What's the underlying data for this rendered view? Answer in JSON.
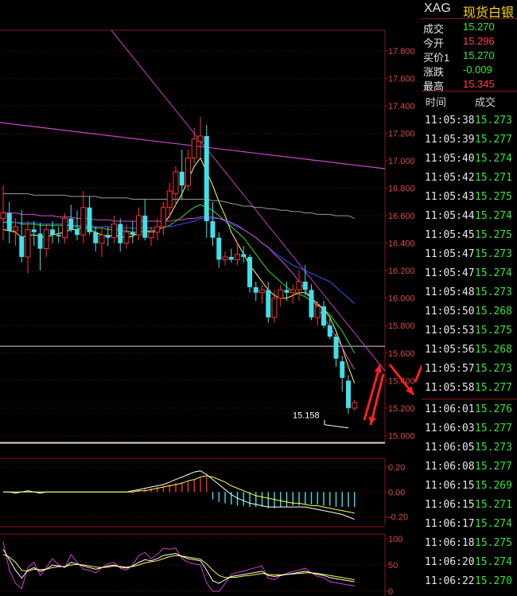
{
  "chart_data": [
    {
      "type": "candlestick",
      "ylim": [
        14.95,
        17.95
      ],
      "yticks": [
        "17.800",
        "17.600",
        "17.400",
        "17.200",
        "17.000",
        "16.800",
        "16.600",
        "16.400",
        "16.200",
        "16.000",
        "15.800",
        "15.600",
        "15.400",
        "15.200",
        "15.000"
      ],
      "candles": [
        [
          16.58,
          16.82,
          16.42,
          16.62
        ],
        [
          16.62,
          16.7,
          16.4,
          16.49
        ],
        [
          16.49,
          16.58,
          16.38,
          16.52
        ],
        [
          16.45,
          16.64,
          16.26,
          16.3
        ],
        [
          16.3,
          16.56,
          16.18,
          16.5
        ],
        [
          16.5,
          16.56,
          16.38,
          16.48
        ],
        [
          16.47,
          16.55,
          16.2,
          16.36
        ],
        [
          16.36,
          16.54,
          16.3,
          16.5
        ],
        [
          16.5,
          16.56,
          16.4,
          16.46
        ],
        [
          16.46,
          16.52,
          16.4,
          16.45
        ],
        [
          16.44,
          16.62,
          16.4,
          16.58
        ],
        [
          16.58,
          16.68,
          16.48,
          16.5
        ],
        [
          16.5,
          16.64,
          16.42,
          16.46
        ],
        [
          16.46,
          16.78,
          16.4,
          16.66
        ],
        [
          16.66,
          16.74,
          16.46,
          16.48
        ],
        [
          16.48,
          16.52,
          16.34,
          16.4
        ],
        [
          16.4,
          16.52,
          16.3,
          16.46
        ],
        [
          16.46,
          16.52,
          16.38,
          16.44
        ],
        [
          16.44,
          16.6,
          16.4,
          16.54
        ],
        [
          16.54,
          16.58,
          16.34,
          16.4
        ],
        [
          16.4,
          16.54,
          16.36,
          16.48
        ],
        [
          16.48,
          16.56,
          16.4,
          16.46
        ],
        [
          16.46,
          16.66,
          16.42,
          16.6
        ],
        [
          16.6,
          16.72,
          16.42,
          16.44
        ],
        [
          16.44,
          16.52,
          16.38,
          16.48
        ],
        [
          16.48,
          16.58,
          16.42,
          16.52
        ],
        [
          16.52,
          16.7,
          16.46,
          16.66
        ],
        [
          16.66,
          16.84,
          16.58,
          16.78
        ],
        [
          16.76,
          16.96,
          16.68,
          16.92
        ],
        [
          16.92,
          17.08,
          16.72,
          16.82
        ],
        [
          16.82,
          17.08,
          16.78,
          17.02
        ],
        [
          17.02,
          17.24,
          16.98,
          17.16
        ],
        [
          17.14,
          17.32,
          17.02,
          17.18
        ],
        [
          17.18,
          17.26,
          16.44,
          16.56
        ],
        [
          16.56,
          16.7,
          16.38,
          16.44
        ],
        [
          16.44,
          16.48,
          16.22,
          16.28
        ],
        [
          16.28,
          16.34,
          16.24,
          16.3
        ],
        [
          16.3,
          16.36,
          16.26,
          16.28
        ],
        [
          16.28,
          16.4,
          16.24,
          16.32
        ],
        [
          16.32,
          16.38,
          16.26,
          16.3
        ],
        [
          16.3,
          16.32,
          16.04,
          16.08
        ],
        [
          16.08,
          16.12,
          15.98,
          16.04
        ],
        [
          16.04,
          16.1,
          15.96,
          16.06
        ],
        [
          16.06,
          16.12,
          15.82,
          15.86
        ],
        [
          15.86,
          16.06,
          15.82,
          16.0
        ],
        [
          16.0,
          16.1,
          15.94,
          16.06
        ],
        [
          16.06,
          16.12,
          15.98,
          16.04
        ],
        [
          16.04,
          16.1,
          15.96,
          16.06
        ],
        [
          16.06,
          16.2,
          15.98,
          16.12
        ],
        [
          16.12,
          16.24,
          16.02,
          16.06
        ],
        [
          16.06,
          16.1,
          15.84,
          15.86
        ],
        [
          15.86,
          15.98,
          15.8,
          15.94
        ],
        [
          15.94,
          15.98,
          15.78,
          15.8
        ],
        [
          15.8,
          15.86,
          15.7,
          15.72
        ],
        [
          15.72,
          15.74,
          15.5,
          15.56
        ],
        [
          15.54,
          15.58,
          15.32,
          15.42
        ],
        [
          15.4,
          15.44,
          15.16,
          15.2
        ],
        [
          15.2,
          15.26,
          15.18,
          15.24
        ]
      ],
      "ma": [
        {
          "color": "#ffff66",
          "values": [
            16.5,
            16.49,
            16.48,
            16.44,
            16.46,
            16.46,
            16.45,
            16.44,
            16.46,
            16.47,
            16.48,
            16.5,
            16.5,
            16.52,
            16.5,
            16.48,
            16.46,
            16.45,
            16.46,
            16.45,
            16.44,
            16.45,
            16.48,
            16.49,
            16.48,
            16.49,
            16.54,
            16.6,
            16.68,
            16.76,
            16.86,
            16.96,
            17.02,
            16.92,
            16.82,
            16.7,
            16.6,
            16.48,
            16.4,
            16.32,
            16.24,
            16.18,
            16.12,
            16.06,
            16.02,
            16.0,
            16.0,
            16.02,
            16.04,
            16.04,
            16.0,
            15.96,
            15.92,
            15.86,
            15.76,
            15.64,
            15.5,
            15.38
          ]
        },
        {
          "color": "#33dd33",
          "values": [
            16.55,
            16.55,
            16.55,
            16.54,
            16.54,
            16.54,
            16.53,
            16.53,
            16.53,
            16.53,
            16.53,
            16.53,
            16.52,
            16.52,
            16.52,
            16.51,
            16.51,
            16.5,
            16.5,
            16.49,
            16.49,
            16.48,
            16.48,
            16.49,
            16.49,
            16.5,
            16.51,
            16.53,
            16.56,
            16.59,
            16.63,
            16.66,
            16.68,
            16.66,
            16.64,
            16.6,
            16.56,
            16.52,
            16.48,
            16.44,
            16.38,
            16.32,
            16.26,
            16.2,
            16.16,
            16.12,
            16.08,
            16.05,
            16.03,
            16.01,
            15.98,
            15.95,
            15.92,
            15.88,
            15.82,
            15.76,
            15.68,
            15.6
          ]
        },
        {
          "color": "#3355ff",
          "values": [
            16.56,
            16.56,
            16.55,
            16.55,
            16.55,
            16.55,
            16.54,
            16.54,
            16.54,
            16.54,
            16.54,
            16.53,
            16.53,
            16.53,
            16.53,
            16.52,
            16.52,
            16.52,
            16.51,
            16.51,
            16.51,
            16.51,
            16.51,
            16.51,
            16.51,
            16.51,
            16.52,
            16.52,
            16.53,
            16.54,
            16.55,
            16.56,
            16.58,
            16.58,
            16.58,
            16.58,
            16.56,
            16.54,
            16.52,
            16.5,
            16.47,
            16.44,
            16.4,
            16.37,
            16.33,
            16.3,
            16.27,
            16.24,
            16.22,
            16.2,
            16.18,
            16.16,
            16.14,
            16.12,
            16.08,
            16.04,
            16.0,
            15.96
          ]
        },
        {
          "color": "#d050d0",
          "values": [
            16.62,
            16.62,
            16.62,
            16.61,
            16.61,
            16.61,
            16.6,
            16.6,
            16.6,
            16.59,
            16.59,
            16.59,
            16.58,
            16.58,
            16.58,
            16.57,
            16.57,
            16.57,
            16.56,
            16.56,
            16.56,
            16.56,
            16.56,
            16.56,
            16.56,
            16.56,
            16.56,
            16.56,
            16.57,
            16.57,
            16.58,
            16.58,
            16.59,
            16.59,
            16.59,
            16.58,
            16.57,
            16.55,
            16.53,
            16.5,
            16.47,
            16.44,
            16.4,
            16.37,
            16.32,
            16.28,
            16.23,
            16.18,
            16.12,
            16.06,
            16.0,
            15.93,
            15.86,
            15.79,
            15.72,
            15.64,
            15.56,
            15.48
          ]
        },
        {
          "color": "#9a9a9a",
          "values": [
            16.76,
            16.76,
            16.76,
            16.76,
            16.76,
            16.75,
            16.75,
            16.75,
            16.75,
            16.75,
            16.75,
            16.74,
            16.74,
            16.74,
            16.74,
            16.74,
            16.73,
            16.73,
            16.73,
            16.73,
            16.73,
            16.72,
            16.72,
            16.72,
            16.72,
            16.72,
            16.72,
            16.72,
            16.72,
            16.72,
            16.72,
            16.72,
            16.72,
            16.72,
            16.71,
            16.71,
            16.7,
            16.69,
            16.68,
            16.67,
            16.67,
            16.66,
            16.66,
            16.65,
            16.65,
            16.64,
            16.64,
            16.63,
            16.63,
            16.62,
            16.62,
            16.61,
            16.61,
            16.61,
            16.6,
            16.6,
            16.6,
            16.58
          ]
        }
      ],
      "hlines": [
        "15.65",
        "14.95"
      ],
      "annotation": {
        "label": "15.158"
      },
      "trendlines": [
        "#c040c0",
        "#cc44cc"
      ],
      "arrows": [
        "#ff2020"
      ]
    },
    {
      "type": "macd",
      "ylim": [
        -0.26,
        0.27
      ],
      "yticks": [
        "0.20",
        "0.00",
        "-0.20"
      ],
      "hist": [
        0.0,
        0.0,
        0.0,
        0.0,
        0.0,
        0.0,
        0.0,
        0.0,
        0.0,
        0.0,
        0.0,
        0.0,
        0.0,
        0.0,
        0.0,
        0.0,
        0.0,
        0.0,
        0.0,
        0.0,
        0.0,
        0.0,
        0.02,
        0.03,
        0.03,
        0.04,
        0.05,
        0.06,
        0.07,
        0.08,
        0.09,
        0.1,
        0.11,
        0.12,
        -0.06,
        -0.08,
        -0.09,
        -0.1,
        -0.11,
        -0.11,
        -0.12,
        -0.12,
        -0.12,
        -0.13,
        -0.13,
        -0.12,
        -0.12,
        -0.11,
        -0.11,
        -0.1,
        -0.1,
        -0.1,
        -0.11,
        -0.11,
        -0.12,
        -0.12,
        -0.12,
        -0.12
      ],
      "dif": [
        0.0,
        0.0,
        -0.01,
        0.0,
        0.01,
        0.0,
        -0.01,
        0.0,
        0.0,
        0.0,
        0.0,
        0.0,
        0.0,
        0.0,
        0.0,
        0.0,
        0.0,
        0.0,
        0.0,
        0.0,
        0.0,
        0.01,
        0.02,
        0.03,
        0.04,
        0.05,
        0.06,
        0.08,
        0.1,
        0.12,
        0.14,
        0.16,
        0.17,
        0.14,
        0.1,
        0.06,
        0.02,
        -0.02,
        -0.05,
        -0.07,
        -0.09,
        -0.1,
        -0.11,
        -0.12,
        -0.12,
        -0.12,
        -0.12,
        -0.12,
        -0.12,
        -0.12,
        -0.13,
        -0.14,
        -0.15,
        -0.16,
        -0.17,
        -0.18,
        -0.2,
        -0.22
      ],
      "dea": [
        0.0,
        0.0,
        0.0,
        0.0,
        0.0,
        0.0,
        0.0,
        0.0,
        0.0,
        0.0,
        0.0,
        0.0,
        0.0,
        0.0,
        0.0,
        0.0,
        0.0,
        0.0,
        0.0,
        0.0,
        0.0,
        0.0,
        0.01,
        0.01,
        0.02,
        0.03,
        0.04,
        0.05,
        0.06,
        0.07,
        0.09,
        0.1,
        0.12,
        0.13,
        0.12,
        0.1,
        0.08,
        0.05,
        0.03,
        0.01,
        -0.01,
        -0.03,
        -0.04,
        -0.05,
        -0.06,
        -0.07,
        -0.08,
        -0.09,
        -0.09,
        -0.1,
        -0.11,
        -0.11,
        -0.12,
        -0.13,
        -0.14,
        -0.15,
        -0.16,
        -0.17
      ]
    },
    {
      "type": "kdj",
      "ylim": [
        0,
        100
      ],
      "yticks": [
        "100",
        "50",
        "0"
      ],
      "k": [
        80,
        60,
        40,
        25,
        40,
        45,
        38,
        42,
        50,
        48,
        46,
        55,
        52,
        48,
        45,
        42,
        45,
        48,
        50,
        46,
        44,
        48,
        55,
        60,
        58,
        62,
        68,
        70,
        72,
        66,
        62,
        60,
        58,
        40,
        20,
        15,
        22,
        28,
        30,
        32,
        34,
        36,
        38,
        30,
        28,
        30,
        32,
        34,
        36,
        38,
        35,
        32,
        30,
        26,
        24,
        22,
        20,
        18
      ],
      "d": [
        70,
        65,
        55,
        40,
        38,
        42,
        41,
        42,
        45,
        47,
        47,
        50,
        51,
        50,
        48,
        46,
        45,
        46,
        48,
        47,
        46,
        47,
        50,
        54,
        56,
        58,
        62,
        66,
        68,
        67,
        65,
        63,
        61,
        52,
        40,
        30,
        26,
        26,
        27,
        29,
        30,
        32,
        34,
        32,
        31,
        31,
        32,
        33,
        34,
        35,
        35,
        34,
        32,
        30,
        28,
        26,
        24,
        22
      ],
      "j": [
        95,
        40,
        15,
        5,
        45,
        55,
        30,
        45,
        62,
        50,
        45,
        70,
        55,
        42,
        40,
        35,
        45,
        52,
        55,
        44,
        40,
        50,
        68,
        74,
        62,
        70,
        82,
        80,
        82,
        62,
        55,
        52,
        50,
        16,
        0,
        0,
        15,
        32,
        36,
        38,
        42,
        45,
        48,
        25,
        22,
        30,
        34,
        38,
        40,
        44,
        35,
        28,
        26,
        18,
        16,
        14,
        12,
        10
      ]
    }
  ],
  "quote": {
    "symbol": "XAG",
    "name": "现货白银",
    "rows": [
      {
        "label": "成交",
        "value": "15.270",
        "color": "#33e633"
      },
      {
        "label": "今开",
        "value": "15.296",
        "color": "#ff4040"
      },
      {
        "label": "买价1",
        "value": "15.270",
        "color": "#33e633"
      },
      {
        "label": "涨跌",
        "value": "-0.009",
        "color": "#33e633"
      },
      {
        "label": "最高",
        "value": "15.345",
        "color": "#ff4040"
      }
    ]
  },
  "ticks": {
    "header_time": "时间",
    "header_price": "成交",
    "rows": [
      {
        "time": "11:05:38",
        "price": "15.273"
      },
      {
        "time": "11:05:39",
        "price": "15.277"
      },
      {
        "time": "11:05:40",
        "price": "15.274"
      },
      {
        "time": "11:05:42",
        "price": "15.271"
      },
      {
        "time": "11:05:43",
        "price": "15.275"
      },
      {
        "time": "11:05:44",
        "price": "15.274"
      },
      {
        "time": "11:05:45",
        "price": "15.275"
      },
      {
        "time": "11:05:47",
        "price": "15.273"
      },
      {
        "time": "11:05:47",
        "price": "15.274"
      },
      {
        "time": "11:05:48",
        "price": "15.273"
      },
      {
        "time": "11:05:50",
        "price": "15.268"
      },
      {
        "time": "11:05:53",
        "price": "15.275"
      },
      {
        "time": "11:05:56",
        "price": "15.268"
      },
      {
        "time": "11:05:57",
        "price": "15.273"
      },
      {
        "time": "11:05:58",
        "price": "15.277"
      },
      {
        "time": "11:06:01",
        "price": "15.276"
      },
      {
        "time": "11:06:03",
        "price": "15.277"
      },
      {
        "time": "11:06:05",
        "price": "15.273"
      },
      {
        "time": "11:06:08",
        "price": "15.277"
      },
      {
        "time": "11:06:15",
        "price": "15.269"
      },
      {
        "time": "11:06:15",
        "price": "15.271"
      },
      {
        "time": "11:06:17",
        "price": "15.274"
      },
      {
        "time": "11:06:18",
        "price": "15.275"
      },
      {
        "time": "11:06:20",
        "price": "15.274"
      },
      {
        "time": "11:06:22",
        "price": "15.270"
      }
    ]
  }
}
